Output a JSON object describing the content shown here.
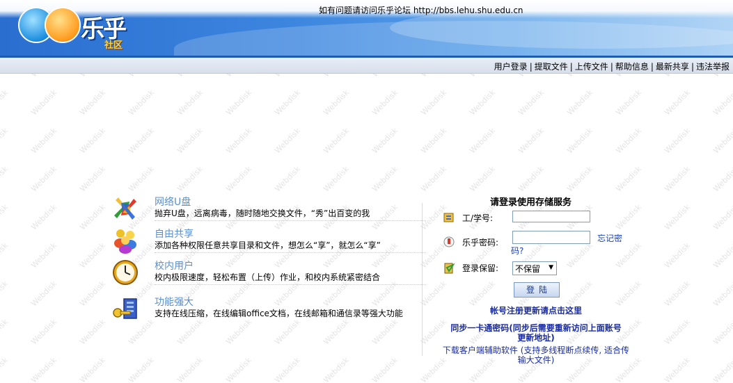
{
  "header": {
    "notice": "如有问题请访问乐乎论坛 http://bbs.lehu.shu.edu.cn",
    "logo_text": "乐乎",
    "logo_sub": "社区"
  },
  "nav": {
    "items": [
      "用户登录",
      "提取文件",
      "上传文件",
      "帮助信息",
      "最新共享",
      "违法举报"
    ],
    "separator": "|"
  },
  "watermark": "Webdisk",
  "features": [
    {
      "title": "网络U盘",
      "desc": "抛弃U盘，远离病毒，随时随地交换文件，“秀”出百变的我",
      "icon": "exchange-arrows-icon"
    },
    {
      "title": "自由共享",
      "desc": "添加各种权限任意共享目录和文件，想怎么“享”，就怎么“享”",
      "icon": "users-group-icon"
    },
    {
      "title": "校内用户",
      "desc": "校内极限速度，轻松布置（上传）作业，和校内系统紧密结合",
      "icon": "clock-icon"
    },
    {
      "title": "功能强大",
      "desc": "支持在线压缩，在线编辑office文档，在线邮箱和通信录等强大功能",
      "icon": "key-tools-icon"
    }
  ],
  "login": {
    "heading": "请登录使用存储服务",
    "id_label": "工/学号:",
    "password_label": "乐乎密码:",
    "forgot_line1": "忘记密",
    "forgot_line2": "码?",
    "keep_label": "登录保留:",
    "keep_value": "不保留",
    "login_button": "登陆",
    "register_link": "帐号注册更新请点击这里",
    "sync_link_line1": "同步一卡通密码(同步后需要重新访问上面账号",
    "sync_link_line2": "更新地址)",
    "download_line1": "下载客户端辅助软件 (支持多线程断点续传, 适合传",
    "download_line2": "输大文件)"
  }
}
